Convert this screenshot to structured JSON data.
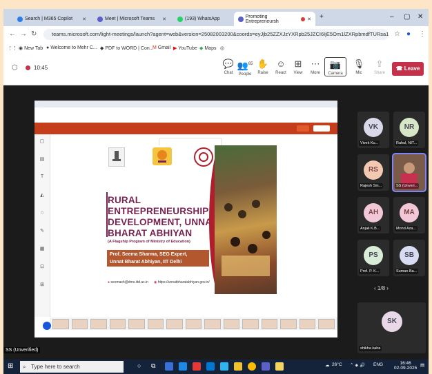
{
  "browser": {
    "tabs": [
      {
        "label": "Search | M365 Copilot",
        "icon": "copilot-icon"
      },
      {
        "label": "Meet | Microsoft Teams",
        "icon": "teams-icon"
      },
      {
        "label": "(193) WhatsApp",
        "icon": "whatsapp-icon"
      },
      {
        "label": "Promoting Entrepreneursh",
        "icon": "teams-icon"
      }
    ],
    "new_tab": "+",
    "minimize": "–",
    "maximize": "▢",
    "close": "✕",
    "url": "teams.microsoft.com/light-meetings/launch?agent=web&version=25082003200&coords=eyJjb25ZZXJzYXRpb25JZCI6IjE5Om1lZXRpbmdfTURsa1lqVXlaamN0WmpSaU15MD...",
    "bookmarks": [
      "New Tab",
      "Welcome to Mehr C...",
      "PDF to WORD | Con...",
      "Gmail",
      "YouTube",
      "Maps"
    ]
  },
  "meeting": {
    "time": "10:45",
    "toolbar": [
      {
        "label": "Chat",
        "icon": "chat-icon"
      },
      {
        "label": "People",
        "icon": "people-icon",
        "badge": "65"
      },
      {
        "label": "Raise",
        "icon": "raise-hand-icon"
      },
      {
        "label": "React",
        "icon": "react-icon"
      },
      {
        "label": "View",
        "icon": "view-icon"
      },
      {
        "label": "More",
        "icon": "more-icon"
      },
      {
        "label": "Camera",
        "icon": "camera-icon"
      },
      {
        "label": "Mic",
        "icon": "mic-icon"
      },
      {
        "label": "Share",
        "icon": "share-icon"
      }
    ],
    "leave_label": "Leave",
    "leave_color": "#c4314b"
  },
  "slide": {
    "title_lines": [
      "RURAL",
      "ENTREPRENEURSHIP",
      "DEVELOPMENT, UNNAT",
      "BHARAT ABHIYAN"
    ],
    "subtitle": "(A Flagship Program of Ministry of Education)",
    "presenter_lines": [
      "Prof. Seema Sharma, SEG Expert,",
      "Unnat Bharat Abhiyan, IIT Delhi"
    ],
    "email": "seemash@dms.iitd.ac.in",
    "website": "https://unnatbharatabhiyan.gov.in/",
    "title_color": "#7a2350",
    "band_color": "#b2572e"
  },
  "participants": [
    {
      "initials": "VK",
      "name": "Vivek Ku...",
      "color": "#d8d8e8"
    },
    {
      "initials": "NR",
      "name": "Rahul, NIT...",
      "color": "#d8e6c8"
    },
    {
      "initials": "RS",
      "name": "Rajesh Sin...",
      "color": "#f2c8b0"
    },
    {
      "initials": "",
      "name": "SS (Unveri...",
      "color": "#6b4a3a"
    },
    {
      "initials": "AH",
      "name": "Anjali K.B...",
      "color": "#f2c8d8"
    },
    {
      "initials": "MA",
      "name": "Mohd Aza...",
      "color": "#f2c8d8"
    },
    {
      "initials": "PS",
      "name": "Prof. P. K...",
      "color": "#d8ecd8"
    },
    {
      "initials": "SB",
      "name": "Suman Ba...",
      "color": "#d8dcf2"
    }
  ],
  "pager": "1/8",
  "big_tile": {
    "initials": "SK",
    "name": "shikha kalra",
    "color": "#e8d8e8"
  },
  "self_name": "SS (Unverified)",
  "taskbar": {
    "search_placeholder": "Type here to search",
    "weather": "26°C",
    "lang": "ENG",
    "time": "16:46",
    "date": "02-09-2025"
  }
}
